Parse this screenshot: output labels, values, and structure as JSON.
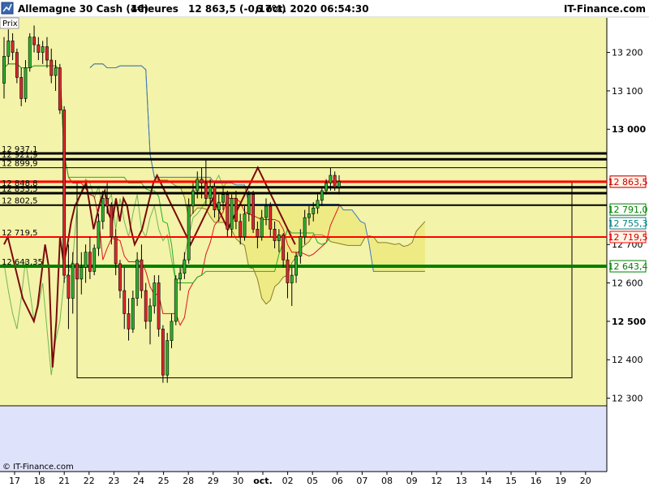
{
  "header": {
    "title": "Allemagne 30 Cash (1€)",
    "period": "4 heures",
    "quote": "12 863,5 (-0,17%)",
    "datetime": "6 oct. 2020 06:54:30",
    "brand": "IT-Finance.com"
  },
  "footer": {
    "copyright": "© IT-Finance.com"
  },
  "panel_label": "Prix",
  "chart_data": {
    "type": "candlestick",
    "ylim": [
      12280,
      13290
    ],
    "y_ticks": [
      {
        "value": 13200,
        "label": "13 200",
        "bold": false
      },
      {
        "value": 13100,
        "label": "13 100",
        "bold": false
      },
      {
        "value": 13000,
        "label": "13 000",
        "bold": true
      },
      {
        "value": 12700,
        "label": "12 700",
        "bold": false
      },
      {
        "value": 12600,
        "label": "12 600",
        "bold": false
      },
      {
        "value": 12500,
        "label": "12 500",
        "bold": true
      },
      {
        "value": 12400,
        "label": "12 400",
        "bold": false
      },
      {
        "value": 12300,
        "label": "12 300",
        "bold": false
      }
    ],
    "x_ticks": [
      {
        "pos": 0,
        "label": "17",
        "bold": false
      },
      {
        "pos": 1,
        "label": "18",
        "bold": false
      },
      {
        "pos": 2,
        "label": "21",
        "bold": false
      },
      {
        "pos": 3,
        "label": "22",
        "bold": false
      },
      {
        "pos": 4,
        "label": "23",
        "bold": false
      },
      {
        "pos": 5,
        "label": "24",
        "bold": false
      },
      {
        "pos": 6,
        "label": "25",
        "bold": false
      },
      {
        "pos": 7,
        "label": "28",
        "bold": false
      },
      {
        "pos": 8,
        "label": "29",
        "bold": false
      },
      {
        "pos": 9,
        "label": "30",
        "bold": false
      },
      {
        "pos": 10,
        "label": "oct.",
        "bold": true
      },
      {
        "pos": 11,
        "label": "02",
        "bold": false
      },
      {
        "pos": 12,
        "label": "05",
        "bold": false
      },
      {
        "pos": 13,
        "label": "06",
        "bold": false
      },
      {
        "pos": 14,
        "label": "07",
        "bold": false
      },
      {
        "pos": 15,
        "label": "08",
        "bold": false
      },
      {
        "pos": 16,
        "label": "09",
        "bold": false
      },
      {
        "pos": 17,
        "label": "12",
        "bold": false
      },
      {
        "pos": 18,
        "label": "13",
        "bold": false
      },
      {
        "pos": 19,
        "label": "14",
        "bold": false
      },
      {
        "pos": 20,
        "label": "15",
        "bold": false
      },
      {
        "pos": 21,
        "label": "16",
        "bold": false
      },
      {
        "pos": 22,
        "label": "19",
        "bold": false
      },
      {
        "pos": 23,
        "label": "20",
        "bold": false
      }
    ],
    "levels": [
      {
        "value": 12937.1,
        "label": "12 937,1",
        "color": "#000000",
        "width": 3,
        "badge": ""
      },
      {
        "value": 12921.9,
        "label": "12 921,9",
        "color": "#000000",
        "width": 3,
        "badge": ""
      },
      {
        "value": 12899.9,
        "label": "12 899,9",
        "color": "#000000",
        "width": 1,
        "badge": ""
      },
      {
        "value": 12863.5,
        "label": "",
        "color": "#ff0000",
        "width": 3,
        "badge": "12 863,5"
      },
      {
        "value": 12848.8,
        "label": "12 848,8",
        "color": "#000000",
        "width": 3,
        "badge": ""
      },
      {
        "value": 12833.5,
        "label": "12 833,5",
        "color": "#000000",
        "width": 3,
        "badge": ""
      },
      {
        "value": 12802.5,
        "label": "12 802,5",
        "color": "#000000",
        "width": 2,
        "badge": ""
      },
      {
        "value": 12719.5,
        "label": "12 719,5",
        "color": "#ff0000",
        "width": 2,
        "badge": "12 719,5"
      },
      {
        "value": 12643.35,
        "label": "12 643,35",
        "color": "#008000",
        "width": 4,
        "badge": "12 643,4"
      }
    ],
    "side_badges": [
      {
        "value": 12863.5,
        "label": "12 863,5",
        "color": "#cc0000",
        "fill": "#fff4e8"
      },
      {
        "value": 12791.0,
        "label": "12 791,0",
        "color": "#008000",
        "fill": "#ffffff"
      },
      {
        "value": 12755.3,
        "label": "12 755,3",
        "color": "#008080",
        "fill": "#ffffff"
      }
    ],
    "rect_range": [
      12353,
      12863.5
    ],
    "candles": [
      {
        "o": 13120,
        "h": 13240,
        "l": 13080,
        "c": 13190
      },
      {
        "o": 13190,
        "h": 13260,
        "l": 13170,
        "c": 13230
      },
      {
        "o": 13230,
        "h": 13250,
        "l": 13180,
        "c": 13200
      },
      {
        "o": 13200,
        "h": 13210,
        "l": 13120,
        "c": 13135
      },
      {
        "o": 13135,
        "h": 13160,
        "l": 13060,
        "c": 13080
      },
      {
        "o": 13080,
        "h": 13180,
        "l": 13070,
        "c": 13160
      },
      {
        "o": 13160,
        "h": 13250,
        "l": 13150,
        "c": 13240
      },
      {
        "o": 13240,
        "h": 13270,
        "l": 13200,
        "c": 13220
      },
      {
        "o": 13220,
        "h": 13240,
        "l": 13180,
        "c": 13200
      },
      {
        "o": 13200,
        "h": 13230,
        "l": 13170,
        "c": 13215
      },
      {
        "o": 13215,
        "h": 13240,
        "l": 13160,
        "c": 13180
      },
      {
        "o": 13180,
        "h": 13210,
        "l": 13120,
        "c": 13140
      },
      {
        "o": 13140,
        "h": 13180,
        "l": 13100,
        "c": 13160
      },
      {
        "o": 13160,
        "h": 13170,
        "l": 13040,
        "c": 13050
      },
      {
        "o": 13050,
        "h": 13060,
        "l": 12600,
        "c": 12620
      },
      {
        "o": 12620,
        "h": 12700,
        "l": 12480,
        "c": 12560
      },
      {
        "o": 12560,
        "h": 12680,
        "l": 12520,
        "c": 12650
      },
      {
        "o": 12650,
        "h": 12720,
        "l": 12590,
        "c": 12610
      },
      {
        "o": 12610,
        "h": 12680,
        "l": 12570,
        "c": 12640
      },
      {
        "o": 12640,
        "h": 12700,
        "l": 12600,
        "c": 12680
      },
      {
        "o": 12680,
        "h": 12720,
        "l": 12610,
        "c": 12630
      },
      {
        "o": 12630,
        "h": 12700,
        "l": 12620,
        "c": 12690
      },
      {
        "o": 12690,
        "h": 12780,
        "l": 12670,
        "c": 12760
      },
      {
        "o": 12760,
        "h": 12840,
        "l": 12740,
        "c": 12820
      },
      {
        "o": 12820,
        "h": 12860,
        "l": 12780,
        "c": 12800
      },
      {
        "o": 12800,
        "h": 12810,
        "l": 12700,
        "c": 12720
      },
      {
        "o": 12720,
        "h": 12740,
        "l": 12620,
        "c": 12650
      },
      {
        "o": 12650,
        "h": 12660,
        "l": 12560,
        "c": 12580
      },
      {
        "o": 12580,
        "h": 12640,
        "l": 12480,
        "c": 12520
      },
      {
        "o": 12520,
        "h": 12560,
        "l": 12450,
        "c": 12480
      },
      {
        "o": 12480,
        "h": 12580,
        "l": 12470,
        "c": 12560
      },
      {
        "o": 12560,
        "h": 12680,
        "l": 12540,
        "c": 12660
      },
      {
        "o": 12660,
        "h": 12700,
        "l": 12560,
        "c": 12580
      },
      {
        "o": 12580,
        "h": 12600,
        "l": 12480,
        "c": 12500
      },
      {
        "o": 12500,
        "h": 12560,
        "l": 12440,
        "c": 12540
      },
      {
        "o": 12540,
        "h": 12620,
        "l": 12520,
        "c": 12600
      },
      {
        "o": 12600,
        "h": 12620,
        "l": 12460,
        "c": 12480
      },
      {
        "o": 12480,
        "h": 12490,
        "l": 12340,
        "c": 12360
      },
      {
        "o": 12360,
        "h": 12470,
        "l": 12340,
        "c": 12450
      },
      {
        "o": 12450,
        "h": 12520,
        "l": 12430,
        "c": 12500
      },
      {
        "o": 12500,
        "h": 12620,
        "l": 12490,
        "c": 12610
      },
      {
        "o": 12610,
        "h": 12640,
        "l": 12580,
        "c": 12625
      },
      {
        "o": 12625,
        "h": 12680,
        "l": 12610,
        "c": 12660
      },
      {
        "o": 12660,
        "h": 12820,
        "l": 12650,
        "c": 12800
      },
      {
        "o": 12800,
        "h": 12860,
        "l": 12780,
        "c": 12840
      },
      {
        "o": 12840,
        "h": 12890,
        "l": 12820,
        "c": 12870
      },
      {
        "o": 12870,
        "h": 12900,
        "l": 12820,
        "c": 12860
      },
      {
        "o": 12860,
        "h": 12920,
        "l": 12800,
        "c": 12820
      },
      {
        "o": 12820,
        "h": 12870,
        "l": 12800,
        "c": 12850
      },
      {
        "o": 12850,
        "h": 12860,
        "l": 12770,
        "c": 12790
      },
      {
        "o": 12790,
        "h": 12830,
        "l": 12760,
        "c": 12810
      },
      {
        "o": 12810,
        "h": 12850,
        "l": 12790,
        "c": 12830
      },
      {
        "o": 12830,
        "h": 12840,
        "l": 12720,
        "c": 12740
      },
      {
        "o": 12740,
        "h": 12830,
        "l": 12720,
        "c": 12820
      },
      {
        "o": 12820,
        "h": 12840,
        "l": 12740,
        "c": 12760
      },
      {
        "o": 12760,
        "h": 12780,
        "l": 12700,
        "c": 12720
      },
      {
        "o": 12720,
        "h": 12800,
        "l": 12710,
        "c": 12780
      },
      {
        "o": 12780,
        "h": 12840,
        "l": 12760,
        "c": 12830
      },
      {
        "o": 12830,
        "h": 12840,
        "l": 12730,
        "c": 12740
      },
      {
        "o": 12740,
        "h": 12760,
        "l": 12690,
        "c": 12720
      },
      {
        "o": 12720,
        "h": 12790,
        "l": 12710,
        "c": 12770
      },
      {
        "o": 12770,
        "h": 12820,
        "l": 12750,
        "c": 12800
      },
      {
        "o": 12800,
        "h": 12810,
        "l": 12720,
        "c": 12740
      },
      {
        "o": 12740,
        "h": 12760,
        "l": 12690,
        "c": 12710
      },
      {
        "o": 12710,
        "h": 12740,
        "l": 12680,
        "c": 12725
      },
      {
        "o": 12725,
        "h": 12730,
        "l": 12640,
        "c": 12660
      },
      {
        "o": 12660,
        "h": 12680,
        "l": 12560,
        "c": 12600
      },
      {
        "o": 12600,
        "h": 12640,
        "l": 12540,
        "c": 12620
      },
      {
        "o": 12620,
        "h": 12680,
        "l": 12600,
        "c": 12670
      },
      {
        "o": 12670,
        "h": 12740,
        "l": 12650,
        "c": 12720
      },
      {
        "o": 12720,
        "h": 12790,
        "l": 12700,
        "c": 12770
      },
      {
        "o": 12770,
        "h": 12800,
        "l": 12750,
        "c": 12780
      },
      {
        "o": 12780,
        "h": 12810,
        "l": 12760,
        "c": 12795
      },
      {
        "o": 12795,
        "h": 12830,
        "l": 12780,
        "c": 12815
      },
      {
        "o": 12815,
        "h": 12850,
        "l": 12800,
        "c": 12840
      },
      {
        "o": 12840,
        "h": 12870,
        "l": 12830,
        "c": 12860
      },
      {
        "o": 12860,
        "h": 12900,
        "l": 12840,
        "c": 12880
      },
      {
        "o": 12880,
        "h": 12890,
        "l": 12840,
        "c": 12850
      },
      {
        "o": 12850,
        "h": 12880,
        "l": 12830,
        "c": 12863.5
      }
    ],
    "stoch_osc": [
      12700,
      12720,
      12680,
      12640,
      12600,
      12560,
      12540,
      12520,
      12500,
      12540,
      12620,
      12700,
      12640,
      12380,
      12500,
      12720,
      12650,
      12700,
      12760,
      12800,
      12820,
      12840,
      12860,
      12800,
      12740,
      12780,
      12820,
      12840,
      12780,
      12760,
      12820,
      12760,
      12820,
      12800,
      12740,
      12700,
      12720,
      12740,
      12780,
      12820,
      12860,
      12880,
      12860,
      12840,
      12820,
      12800,
      12780,
      12760,
      12740,
      12720,
      12700,
      12720,
      12740,
      12760,
      12780,
      12800,
      12820,
      12800,
      12780,
      12760,
      12740,
      12760,
      12780,
      12800,
      12820,
      12840,
      12860,
      12880,
      12900,
      12880,
      12860,
      12840,
      12820,
      12800,
      12780,
      12760,
      12740,
      12720,
      12700
    ]
  }
}
